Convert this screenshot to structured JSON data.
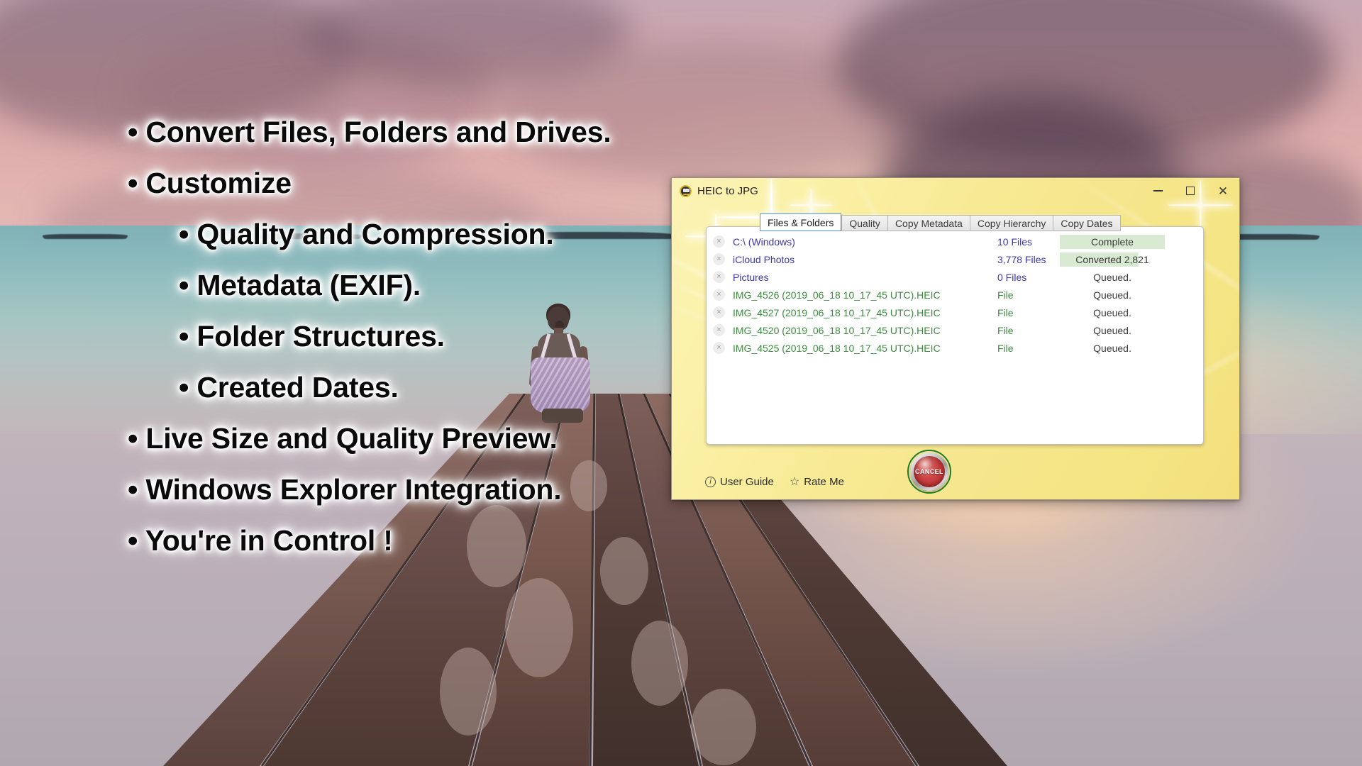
{
  "promo": {
    "bullets": [
      {
        "text": "Convert Files, Folders and Drives.",
        "level": 1
      },
      {
        "text": "Customize",
        "level": 1
      },
      {
        "text": "Quality and Compression.",
        "level": 2
      },
      {
        "text": "Metadata (EXIF).",
        "level": 2
      },
      {
        "text": "Folder Structures.",
        "level": 2
      },
      {
        "text": "Created Dates.",
        "level": 2
      },
      {
        "text": "Live Size and Quality Preview.",
        "level": 1
      },
      {
        "text": "Windows Explorer Integration.",
        "level": 1
      },
      {
        "text": "You're in Control !",
        "level": 1
      }
    ],
    "bullet_glyph": "•"
  },
  "window": {
    "title": "HEIC to JPG",
    "icon": "app-jpeg-icon",
    "controls": {
      "minimize": "–",
      "maximize": "□",
      "close": "✕"
    },
    "background_color": "#f6e68c"
  },
  "tabs": [
    {
      "label": "Files & Folders",
      "active": true
    },
    {
      "label": "Quality",
      "active": false
    },
    {
      "label": "Copy Metadata",
      "active": false
    },
    {
      "label": "Copy Hierarchy",
      "active": false
    },
    {
      "label": "Copy Dates",
      "active": false
    }
  ],
  "list": {
    "remove_glyph": "×",
    "folder_color": "#3b38a8",
    "file_color": "#3e8a40",
    "progress_color": "#d9ead3",
    "rows": [
      {
        "kind": "folder",
        "name": "C:\\ (Windows)",
        "count": "10 Files",
        "status": "Complete",
        "progress": 100
      },
      {
        "kind": "folder",
        "name": "iCloud Photos",
        "count": "3,778 Files",
        "status": "Converted 2,821",
        "progress": 75
      },
      {
        "kind": "folder",
        "name": "Pictures",
        "count": "0 Files",
        "status": "Queued.",
        "progress": 0
      },
      {
        "kind": "file",
        "name": "IMG_4526 (2019_06_18 10_17_45 UTC).HEIC",
        "count": "File",
        "status": "Queued.",
        "progress": 0
      },
      {
        "kind": "file",
        "name": "IMG_4527 (2019_06_18 10_17_45 UTC).HEIC",
        "count": "File",
        "status": "Queued.",
        "progress": 0
      },
      {
        "kind": "file",
        "name": "IMG_4520 (2019_06_18 10_17_45 UTC).HEIC",
        "count": "File",
        "status": "Queued.",
        "progress": 0
      },
      {
        "kind": "file",
        "name": "IMG_4525 (2019_06_18 10_17_45 UTC).HEIC",
        "count": "File",
        "status": "Queued.",
        "progress": 0
      }
    ]
  },
  "footer": {
    "user_guide": "User Guide",
    "user_guide_icon": "info-icon",
    "rate_me": "Rate Me",
    "rate_me_icon": "star-icon",
    "cancel_label": "CANCEL"
  }
}
